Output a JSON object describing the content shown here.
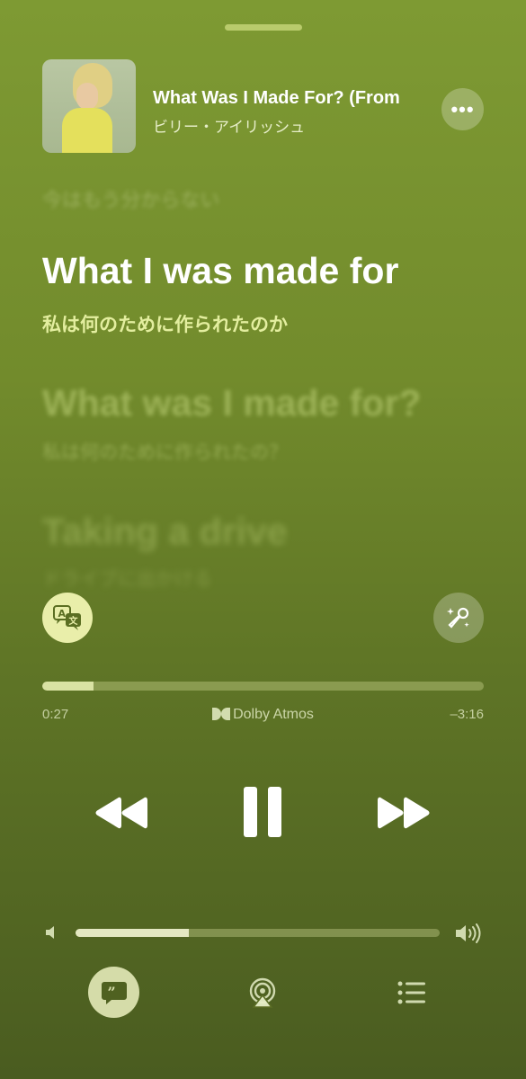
{
  "now_playing": {
    "title": "What Was I Made For? (From",
    "artist": "ビリー・アイリッシュ"
  },
  "lyrics": {
    "previous_translation": "今はもう分からない",
    "current_line": "What I was made for",
    "current_translation": "私は何のために作られたのか",
    "next_line": "What was I made for?",
    "next_translation": "私は何のために作られたの？",
    "next2_line": "Taking a drive",
    "next2_translation": "ドライブに出かける"
  },
  "playback": {
    "elapsed": "0:27",
    "remaining": "–3:16",
    "progress_fraction": 0.117,
    "format_label": "Dolby Atmos",
    "volume_fraction": 0.31
  },
  "icons": {
    "more": "ellipsis-icon",
    "translate": "translate-icon",
    "sing": "microphone-sparkle-icon",
    "rewind": "rewind-icon",
    "pause": "pause-icon",
    "forward": "fast-forward-icon",
    "volume_low": "speaker-low-icon",
    "volume_high": "speaker-high-icon",
    "lyrics": "lyrics-quote-icon",
    "airplay": "airplay-icon",
    "queue": "queue-list-icon"
  },
  "colors": {
    "accent_translation": "#e3ee9f",
    "background_top": "#7e9a33",
    "background_bottom": "#4a5c20"
  }
}
